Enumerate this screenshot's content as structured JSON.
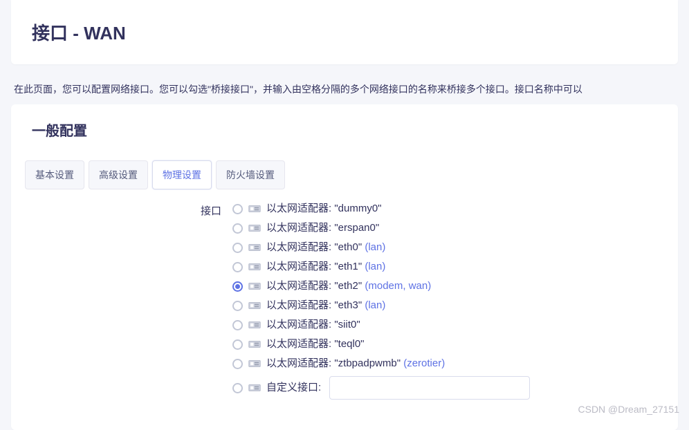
{
  "header": {
    "title": "接口 - WAN"
  },
  "description": "在此页面，您可以配置网络接口。您可以勾选\"桥接接口\"，并输入由空格分隔的多个网络接口的名称来桥接多个接口。接口名称中可以",
  "section": {
    "title": "一般配置"
  },
  "tabs": [
    {
      "label": "基本设置",
      "active": false
    },
    {
      "label": "高级设置",
      "active": false
    },
    {
      "label": "物理设置",
      "active": true
    },
    {
      "label": "防火墙设置",
      "active": false
    }
  ],
  "form": {
    "label": "接口",
    "options": [
      {
        "prefix": "以太网适配器: ",
        "device": "\"dummy0\"",
        "assign": "",
        "selected": false
      },
      {
        "prefix": "以太网适配器: ",
        "device": "\"erspan0\"",
        "assign": "",
        "selected": false
      },
      {
        "prefix": "以太网适配器: ",
        "device": "\"eth0\"",
        "assign": " (lan)",
        "selected": false
      },
      {
        "prefix": "以太网适配器: ",
        "device": "\"eth1\"",
        "assign": " (lan)",
        "selected": false
      },
      {
        "prefix": "以太网适配器: ",
        "device": "\"eth2\"",
        "assign": " (modem, wan)",
        "selected": true
      },
      {
        "prefix": "以太网适配器: ",
        "device": "\"eth3\"",
        "assign": " (lan)",
        "selected": false
      },
      {
        "prefix": "以太网适配器: ",
        "device": "\"siit0\"",
        "assign": "",
        "selected": false
      },
      {
        "prefix": "以太网适配器: ",
        "device": "\"teql0\"",
        "assign": "",
        "selected": false
      },
      {
        "prefix": "以太网适配器: ",
        "device": "\"ztbpadpwmb\"",
        "assign": " (zerotier)",
        "selected": false
      }
    ],
    "custom_label": "自定义接口:",
    "custom_value": ""
  },
  "watermark": "CSDN @Dream_27151"
}
